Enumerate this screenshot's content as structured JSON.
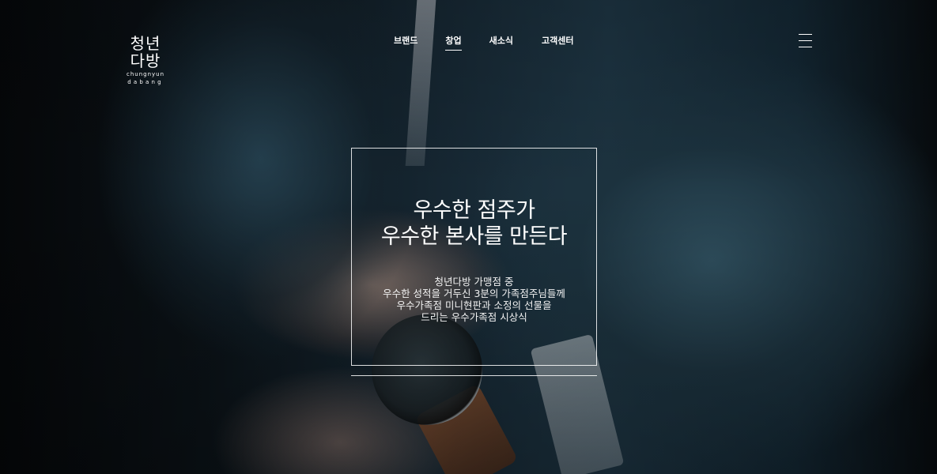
{
  "brand": {
    "logo_line1": "청년",
    "logo_line2": "다방",
    "logo_sub1": "chungnyun",
    "logo_sub2": "dabang"
  },
  "nav": {
    "items": [
      {
        "label": "브랜드",
        "active": false
      },
      {
        "label": "창업",
        "active": true
      },
      {
        "label": "새소식",
        "active": false
      },
      {
        "label": "고객센터",
        "active": false
      }
    ],
    "menu_icon": "hamburger-menu-icon"
  },
  "hero": {
    "headline_line1": "우수한 점주가",
    "headline_line2": "우수한 본사를 만든다",
    "desc_lines": [
      "청년다방 가맹점 중",
      "우수한 성적을 거두신 3분의 가족점주님들께",
      "우수가족점 미니현판과 소정의 선물을",
      "드리는 우수가족점 시상식"
    ]
  },
  "colors": {
    "text": "#ffffff",
    "background": "#0c1116",
    "suit": "#1d3442"
  }
}
